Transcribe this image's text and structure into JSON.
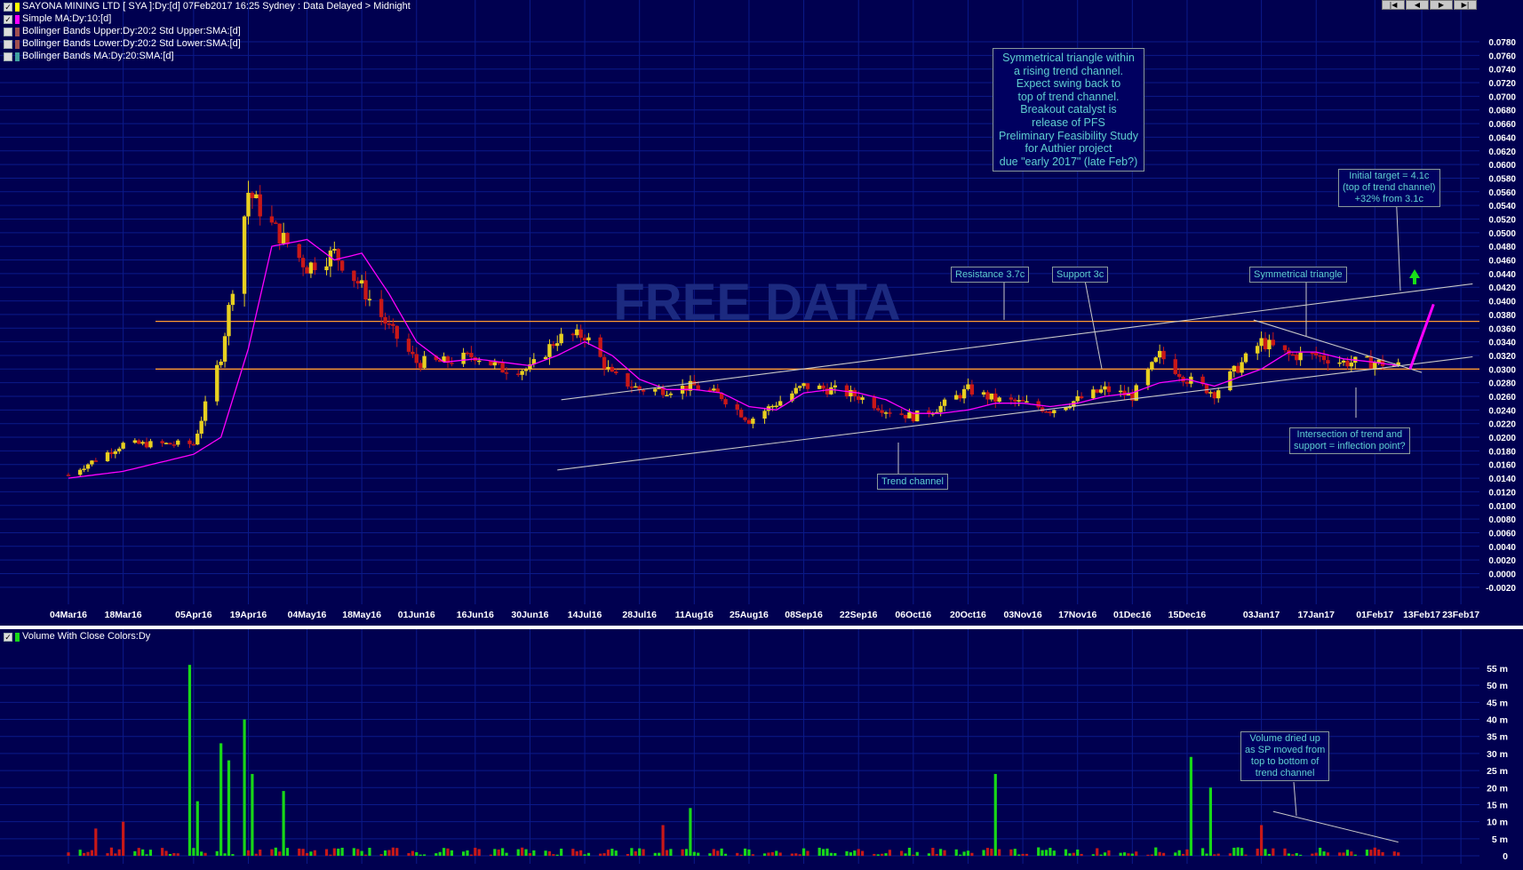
{
  "header": {
    "title": "SAYONA MINING LTD [ SYA ]:Dy:[d]  07Feb2017 16:25 Sydney : Data Delayed > Midnight",
    "legend": [
      {
        "label": "Simple MA:Dy:10:[d]",
        "checked": true,
        "color": "#ff00ff"
      },
      {
        "label": "Bollinger Bands Upper:Dy:20:2 Std Upper:SMA:[d]",
        "checked": false,
        "color": "#a05050"
      },
      {
        "label": "Bollinger Bands Lower:Dy:20:2 Std Lower:SMA:[d]",
        "checked": false,
        "color": "#a05050"
      },
      {
        "label": "Bollinger Bands MA:Dy:20:SMA:[d]",
        "checked": false,
        "color": "#40a0a0"
      }
    ],
    "title_swatch": "#ffff00",
    "nav_buttons": [
      "|◀",
      "◀",
      "▶",
      "▶|"
    ]
  },
  "watermark": "FREE DATA",
  "volume_label": "Volume With Close Colors:Dy",
  "colors": {
    "background": "#000050",
    "grid": "#0b1a8a",
    "up": "#e8d020",
    "down": "#c81818",
    "ma": "#ff00ff",
    "hline": "#ff9a30",
    "trend": "#c8c8c8",
    "vol_up": "#18d818",
    "vol_down": "#c81818",
    "annotation": "#5fd0d0"
  },
  "annotations": {
    "main": "Symmetrical triangle within\na rising trend channel.\nExpect swing back to\ntop of trend channel.\nBreakout catalyst is\nrelease of PFS\nPreliminary Feasibility Study\nfor Authier project\ndue \"early 2017\" (late Feb?)",
    "resistance": "Resistance 3.7c",
    "support": "Support 3c",
    "symtri": "Symmetrical triangle",
    "target": "Initial target = 4.1c\n(top of trend channel)\n+32% from 3.1c",
    "intersection": "Intersection of trend and\nsupport = inflection point?",
    "trend": "Trend channel",
    "volume": "Volume dried up\nas SP moved from\ntop to bottom of\ntrend channel"
  },
  "chart_data": [
    {
      "type": "candlestick",
      "title": "SAYONA MINING LTD [ SYA ]:Dy:[d]",
      "x_tick_labels": [
        "04Mar16",
        "18Mar16",
        "05Apr16",
        "19Apr16",
        "04May16",
        "18May16",
        "01Jun16",
        "16Jun16",
        "30Jun16",
        "14Jul16",
        "28Jul16",
        "11Aug16",
        "25Aug16",
        "08Sep16",
        "22Sep16",
        "06Oct16",
        "20Oct16",
        "03Nov16",
        "17Nov16",
        "01Dec16",
        "15Dec16",
        "03Jan17",
        "17Jan17",
        "01Feb17",
        "13Feb17",
        "23Feb17"
      ],
      "y_tick_labels": [
        "0.0780",
        "0.0760",
        "0.0740",
        "0.0720",
        "0.0700",
        "0.0680",
        "0.0660",
        "0.0640",
        "0.0620",
        "0.0600",
        "0.0580",
        "0.0560",
        "0.0540",
        "0.0520",
        "0.0500",
        "0.0480",
        "0.0460",
        "0.0440",
        "0.0420",
        "0.0400",
        "0.0380",
        "0.0360",
        "0.0340",
        "0.0320",
        "0.0300",
        "0.0280",
        "0.0260",
        "0.0240",
        "0.0220",
        "0.0200",
        "0.0180",
        "0.0160",
        "0.0140",
        "0.0120",
        "0.0100",
        "0.0080",
        "0.0060",
        "0.0040",
        "0.0020",
        "0.0000",
        "-0.0020"
      ],
      "ylim": [
        -0.0022,
        0.0782
      ],
      "grid": true,
      "horizontal_lines": [
        {
          "name": "Resistance 3.7c",
          "value": 0.037
        },
        {
          "name": "Support 3c",
          "value": 0.03
        }
      ],
      "series": [
        {
          "name": "Close (approx.)",
          "x": [
            "04Mar16",
            "18Mar16",
            "05Apr16",
            "12Apr16",
            "19Apr16",
            "25Apr16",
            "04May16",
            "11May16",
            "18May16",
            "25May16",
            "01Jun16",
            "08Jun16",
            "16Jun16",
            "23Jun16",
            "30Jun16",
            "07Jul16",
            "14Jul16",
            "21Jul16",
            "28Jul16",
            "04Aug16",
            "11Aug16",
            "18Aug16",
            "25Aug16",
            "01Sep16",
            "08Sep16",
            "15Sep16",
            "22Sep16",
            "29Sep16",
            "06Oct16",
            "13Oct16",
            "20Oct16",
            "27Oct16",
            "03Nov16",
            "10Nov16",
            "17Nov16",
            "24Nov16",
            "01Dec16",
            "08Dec16",
            "15Dec16",
            "22Dec16",
            "03Jan17",
            "10Jan17",
            "17Jan17",
            "24Jan17",
            "01Feb17",
            "07Feb17"
          ],
          "values": [
            0.0145,
            0.019,
            0.019,
            0.032,
            0.056,
            0.051,
            0.045,
            0.047,
            0.042,
            0.036,
            0.031,
            0.031,
            0.032,
            0.03,
            0.03,
            0.0345,
            0.035,
            0.029,
            0.027,
            0.027,
            0.0275,
            0.026,
            0.0225,
            0.025,
            0.0275,
            0.027,
            0.026,
            0.024,
            0.023,
            0.0245,
            0.027,
            0.0255,
            0.025,
            0.024,
            0.0255,
            0.027,
            0.026,
            0.032,
            0.0285,
            0.0265,
            0.034,
            0.032,
            0.032,
            0.031,
            0.031,
            0.0305
          ]
        },
        {
          "name": "Simple MA:Dy:10:[d]",
          "x": [
            "04Mar16",
            "18Mar16",
            "05Apr16",
            "12Apr16",
            "19Apr16",
            "25Apr16",
            "04May16",
            "11May16",
            "18May16",
            "25May16",
            "01Jun16",
            "08Jun16",
            "16Jun16",
            "23Jun16",
            "30Jun16",
            "07Jul16",
            "14Jul16",
            "21Jul16",
            "28Jul16",
            "04Aug16",
            "11Aug16",
            "18Aug16",
            "25Aug16",
            "01Sep16",
            "08Sep16",
            "15Sep16",
            "22Sep16",
            "29Sep16",
            "06Oct16",
            "13Oct16",
            "20Oct16",
            "27Oct16",
            "03Nov16",
            "10Nov16",
            "17Nov16",
            "24Nov16",
            "01Dec16",
            "08Dec16",
            "15Dec16",
            "22Dec16",
            "03Jan17",
            "10Jan17",
            "17Jan17",
            "24Jan17",
            "01Feb17",
            "07Feb17"
          ],
          "values": [
            0.014,
            0.015,
            0.0175,
            0.02,
            0.033,
            0.048,
            0.049,
            0.046,
            0.047,
            0.041,
            0.034,
            0.031,
            0.0315,
            0.031,
            0.0305,
            0.032,
            0.034,
            0.032,
            0.0285,
            0.027,
            0.027,
            0.0265,
            0.0245,
            0.024,
            0.0265,
            0.027,
            0.0265,
            0.0255,
            0.0235,
            0.0235,
            0.024,
            0.025,
            0.025,
            0.0245,
            0.025,
            0.026,
            0.0265,
            0.028,
            0.0285,
            0.0275,
            0.03,
            0.0325,
            0.0325,
            0.0315,
            0.031,
            0.0305
          ]
        }
      ],
      "trend_lines": [
        {
          "name": "Trend channel upper",
          "from": [
            "08Jul16",
            0.0255
          ],
          "to": [
            "26Feb17",
            0.0425
          ]
        },
        {
          "name": "Trend channel lower",
          "from": [
            "07Jul16",
            0.0152
          ],
          "to": [
            "26Feb17",
            0.0318
          ]
        },
        {
          "name": "Triangle upper",
          "from": [
            "01Jan17",
            0.0372
          ],
          "to": [
            "13Feb17",
            0.0295
          ]
        }
      ],
      "target_arrow": {
        "from": [
          "10Feb17",
          0.03
        ],
        "to": [
          "16Feb17",
          0.0395
        ]
      }
    },
    {
      "type": "bar",
      "title": "Volume With Close Colors:Dy",
      "y_tick_labels": [
        "55 m",
        "50 m",
        "45 m",
        "40 m",
        "35 m",
        "30 m",
        "25 m",
        "20 m",
        "15 m",
        "10 m",
        "5 m",
        "0"
      ],
      "ylim": [
        0,
        57
      ],
      "series": [
        {
          "name": "Volume (m, approx. notable bars)",
          "x": [
            "04Mar16",
            "11Mar16",
            "18Mar16",
            "04Apr16",
            "06Apr16",
            "12Apr16",
            "14Apr16",
            "18Apr16",
            "20Apr16",
            "28Apr16",
            "03Aug16",
            "10Aug16",
            "27Oct16",
            "16Dec16",
            "21Dec16",
            "03Jan17",
            "07Feb17"
          ],
          "values": [
            1,
            8,
            10,
            56,
            16,
            33,
            28,
            40,
            24,
            19,
            9,
            14,
            24,
            29,
            20,
            9,
            1
          ]
        }
      ],
      "annotation_line": {
        "from": [
          "06Jan17",
          13
        ],
        "to": [
          "07Feb17",
          4
        ]
      }
    }
  ]
}
